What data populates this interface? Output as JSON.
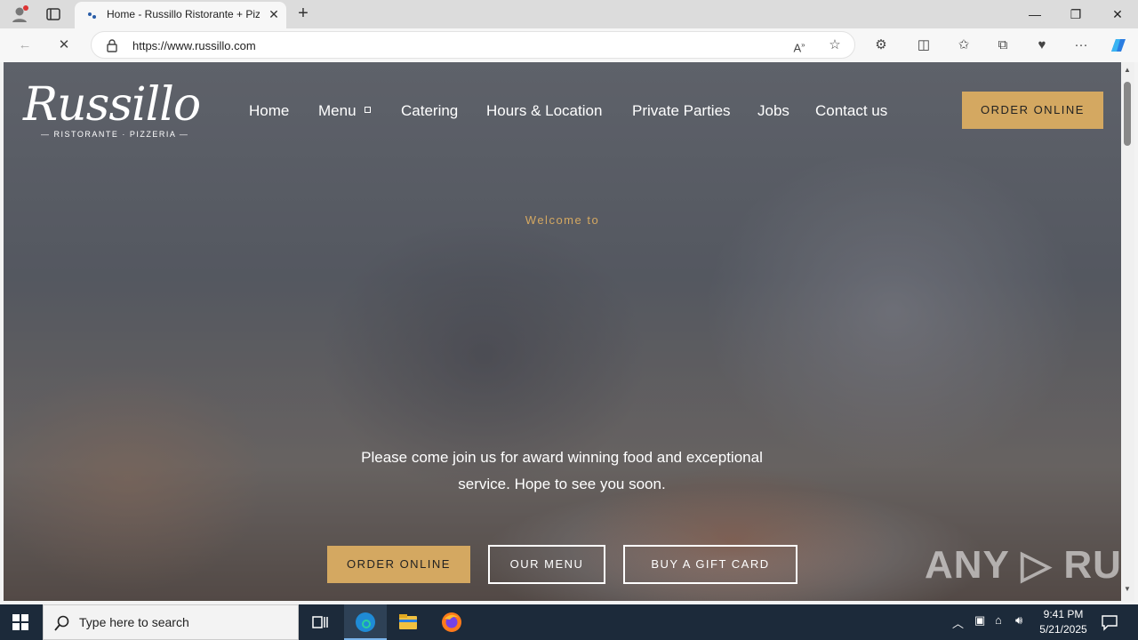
{
  "browser": {
    "tab_title": "Home - Russillo Ristorante + Pizz",
    "url": "https://www.russillo.com",
    "new_tab_label": "+",
    "tab_close_label": "✕",
    "window": {
      "minimize": "—",
      "restore": "❐",
      "close": "✕"
    }
  },
  "site": {
    "logo_text": "Russillo",
    "logo_subtitle": "— RISTORANTE · PIZZERIA —",
    "nav": {
      "home": "Home",
      "menu": "Menu",
      "catering": "Catering",
      "hours": "Hours & Location",
      "private": "Private Parties",
      "jobs": "Jobs",
      "contact": "Contact us"
    },
    "header_order": "ORDER ONLINE",
    "welcome": "Welcome to",
    "tagline": "Please come join us for award winning food and exceptional service. Hope to see you soon.",
    "cta": {
      "order": "ORDER ONLINE",
      "menu": "OUR MENU",
      "gift": "BUY A GIFT CARD"
    },
    "colors": {
      "gold": "#d4a861"
    }
  },
  "watermark": "ANY ▷ RUN",
  "taskbar": {
    "search_placeholder": "Type here to search",
    "time": "9:41 PM",
    "date": "5/21/2025"
  }
}
